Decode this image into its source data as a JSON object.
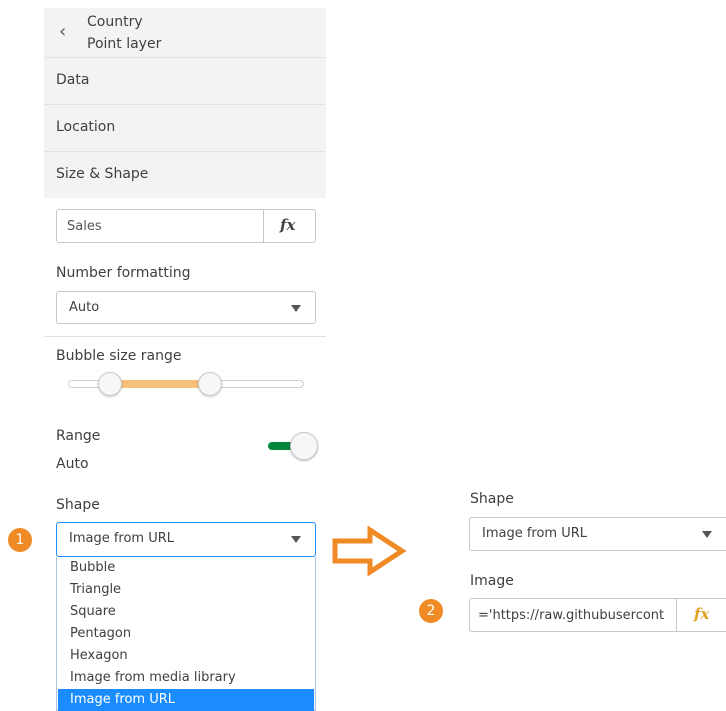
{
  "header": {
    "title": "Country",
    "subtitle": "Point layer"
  },
  "sections": [
    "Data",
    "Location",
    "Size & Shape"
  ],
  "size_field": {
    "value": "Sales",
    "fx_label": "fx"
  },
  "number_formatting": {
    "label": "Number formatting",
    "value": "Auto"
  },
  "bubble_size_range": {
    "label": "Bubble size range",
    "min_fraction": 0.18,
    "max_fraction": 0.6
  },
  "range": {
    "label": "Range",
    "value": "Auto",
    "toggle_on": true
  },
  "shape": {
    "label": "Shape",
    "value": "Image from URL",
    "options": [
      "Bubble",
      "Triangle",
      "Square",
      "Pentagon",
      "Hexagon",
      "Image from media library",
      "Image from URL"
    ],
    "selected_index": 6
  },
  "callouts": {
    "one": "1",
    "two": "2"
  },
  "right_panel": {
    "shape_label": "Shape",
    "shape_value": "Image from URL",
    "image_label": "Image",
    "image_value": "='https://raw.githubusercont",
    "fx_label": "fx"
  },
  "colors": {
    "accent_orange": "#f08a24",
    "toggle_green": "#00873d",
    "slider_range": "#f5c07a",
    "selected_blue": "#1a8cff"
  }
}
